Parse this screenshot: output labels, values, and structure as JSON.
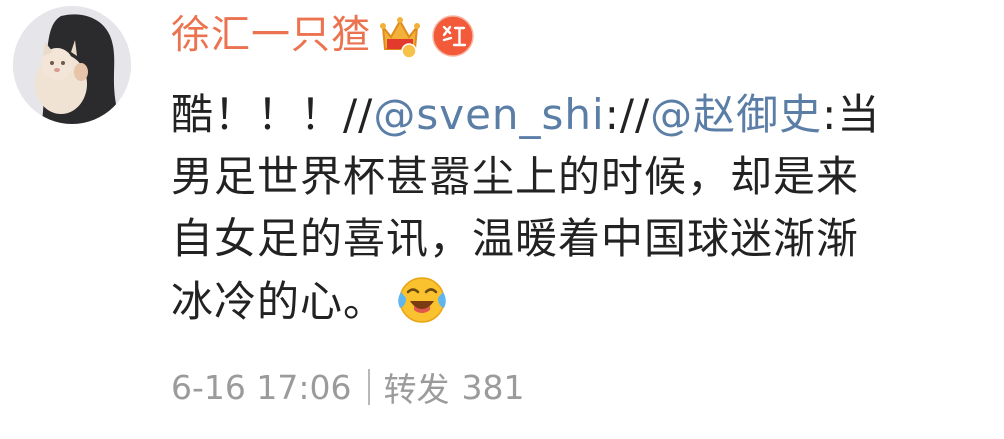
{
  "post": {
    "username": "徐汇一只猹",
    "content": {
      "line1_prefix": "酷！！！",
      "line1_sep1": "//",
      "mention1": "@sven_shi",
      "line1_sep2": "://",
      "mention2": "@赵御史",
      "line1_suffix": ":当",
      "line2": "男足世界杯甚嚣尘上的时候，却是来",
      "line3": "自女足的喜讯，温暖着中国球迷渐渐",
      "line4": "冰冷的心。"
    },
    "emoji": "laughing-tears-emoji",
    "timestamp": "6-16 17:06",
    "repost_label": "转发",
    "repost_count": "381"
  },
  "colors": {
    "username": "#eb7350",
    "mention": "#5b7ea7",
    "text": "#222222",
    "meta": "#9b9b9b"
  }
}
